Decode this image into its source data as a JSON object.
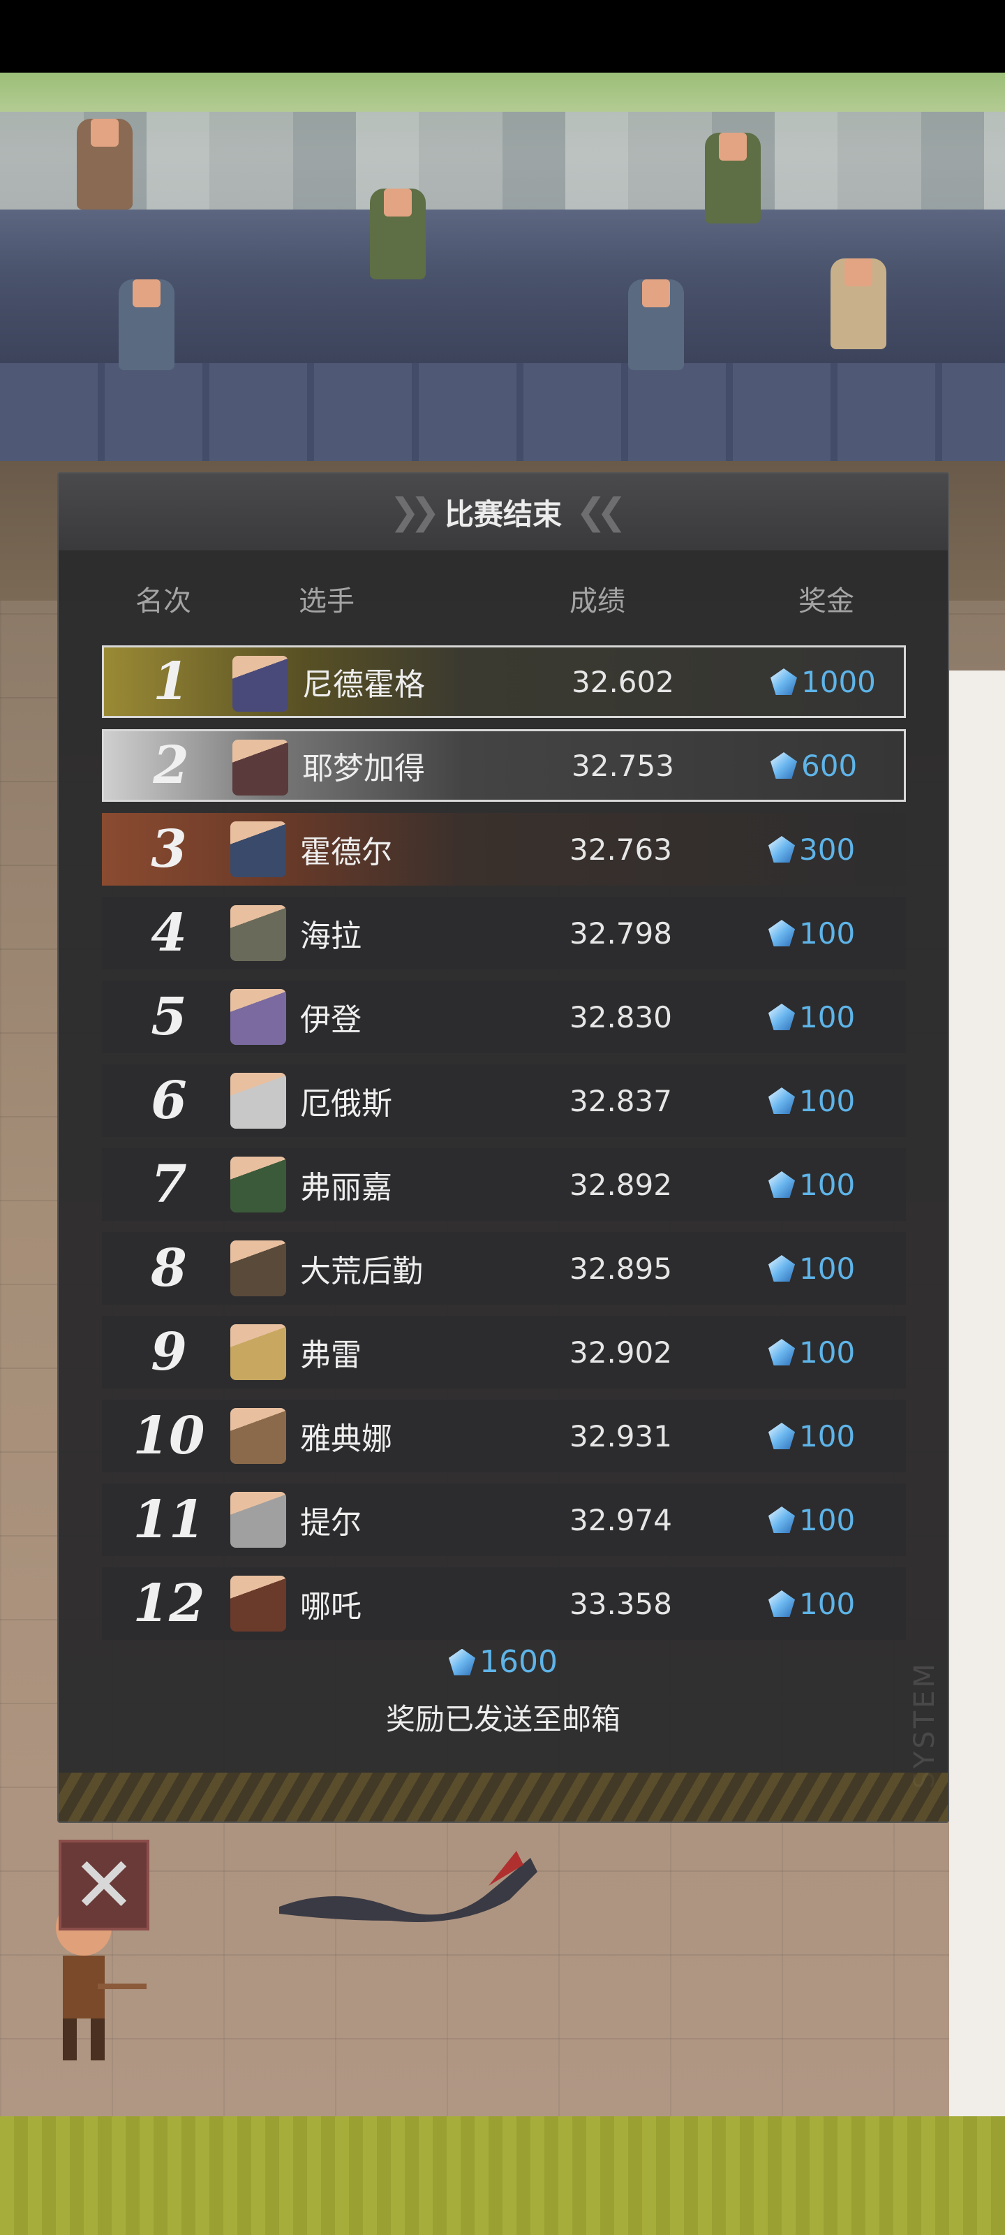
{
  "panel": {
    "title": "比赛结束"
  },
  "columns": {
    "rank": "名次",
    "player": "选手",
    "score": "成绩",
    "prize": "奖金"
  },
  "rows": [
    {
      "rank": "1",
      "name": "尼德霍格",
      "score": "32.602",
      "prize": "1000",
      "avatar_color": "#4a4a7a"
    },
    {
      "rank": "2",
      "name": "耶梦加得",
      "score": "32.753",
      "prize": "600",
      "avatar_color": "#5a3a3a"
    },
    {
      "rank": "3",
      "name": "霍德尔",
      "score": "32.763",
      "prize": "300",
      "avatar_color": "#3a4a6a"
    },
    {
      "rank": "4",
      "name": "海拉",
      "score": "32.798",
      "prize": "100",
      "avatar_color": "#6a6a5a"
    },
    {
      "rank": "5",
      "name": "伊登",
      "score": "32.830",
      "prize": "100",
      "avatar_color": "#7a6aa0"
    },
    {
      "rank": "6",
      "name": "厄俄斯",
      "score": "32.837",
      "prize": "100",
      "avatar_color": "#c8c8c8"
    },
    {
      "rank": "7",
      "name": "弗丽嘉",
      "score": "32.892",
      "prize": "100",
      "avatar_color": "#3a5a3a"
    },
    {
      "rank": "8",
      "name": "大荒后勤",
      "score": "32.895",
      "prize": "100",
      "avatar_color": "#5a4a3a"
    },
    {
      "rank": "9",
      "name": "弗雷",
      "score": "32.902",
      "prize": "100",
      "avatar_color": "#c8a860"
    },
    {
      "rank": "10",
      "name": "雅典娜",
      "score": "32.931",
      "prize": "100",
      "avatar_color": "#8a6a4a"
    },
    {
      "rank": "11",
      "name": "提尔",
      "score": "32.974",
      "prize": "100",
      "avatar_color": "#a0a0a0"
    },
    {
      "rank": "12",
      "name": "哪吒",
      "score": "33.358",
      "prize": "100",
      "avatar_color": "#6a3a2a"
    }
  ],
  "total_prize": "1600",
  "mail_note": "奖励已发送至邮箱",
  "watermark": "SYSTEM",
  "colors": {
    "gem": "#5eb4e8",
    "gold": "#9a8a35",
    "silver": "#cfcfcf",
    "bronze": "#8a4b30"
  },
  "icons": {
    "close": "close-icon",
    "gem": "diamond-gem-icon"
  }
}
